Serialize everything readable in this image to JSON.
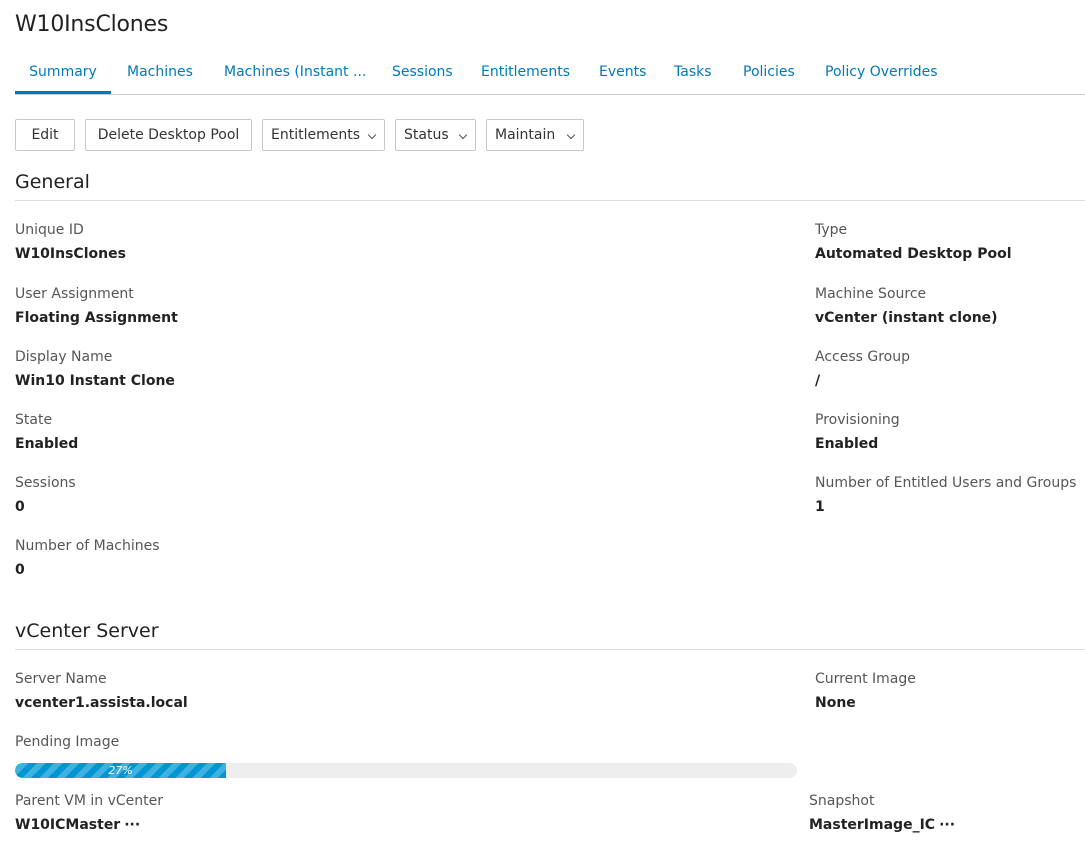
{
  "page": {
    "title": "W10InsClones"
  },
  "tabs": [
    {
      "label": "Summary",
      "active": true
    },
    {
      "label": "Machines"
    },
    {
      "label": "Machines (Instant ..."
    },
    {
      "label": "Sessions"
    },
    {
      "label": "Entitlements"
    },
    {
      "label": "Events"
    },
    {
      "label": "Tasks"
    },
    {
      "label": "Policies"
    },
    {
      "label": "Policy Overrides"
    }
  ],
  "toolbar": {
    "edit": "Edit",
    "delete_pool": "Delete Desktop Pool",
    "entitlements": "Entitlements",
    "status": "Status",
    "maintain": "Maintain"
  },
  "general": {
    "title": "General",
    "unique_id": {
      "label": "Unique ID",
      "value": "W10InsClones"
    },
    "type": {
      "label": "Type",
      "value": "Automated Desktop Pool"
    },
    "user_assignment": {
      "label": "User Assignment",
      "value": "Floating Assignment"
    },
    "machine_source": {
      "label": "Machine Source",
      "value": "vCenter (instant clone)"
    },
    "display_name": {
      "label": "Display Name",
      "value": "Win10 Instant Clone"
    },
    "access_group": {
      "label": "Access Group",
      "value": "/"
    },
    "state": {
      "label": "State",
      "value": "Enabled"
    },
    "provisioning": {
      "label": "Provisioning",
      "value": "Enabled"
    },
    "sessions": {
      "label": "Sessions",
      "value": "0"
    },
    "entitled": {
      "label": "Number of Entitled Users and Groups",
      "value": "1"
    },
    "machines": {
      "label": "Number of Machines",
      "value": "0"
    }
  },
  "vcenter": {
    "title": "vCenter Server",
    "server_name": {
      "label": "Server Name",
      "value": "vcenter1.assista.local"
    },
    "current_image": {
      "label": "Current Image",
      "value": "None"
    },
    "pending_image": {
      "label": "Pending Image",
      "progress_text": "27%",
      "progress": 0.27
    },
    "parent_vm": {
      "label": "Parent VM in vCenter",
      "value": "W10ICMaster",
      "more": "···"
    },
    "snapshot": {
      "label": "Snapshot",
      "value": "MasterImage_IC",
      "more": "···"
    }
  },
  "colors": {
    "accent": "#0079b8",
    "progress": "#0095d3"
  }
}
